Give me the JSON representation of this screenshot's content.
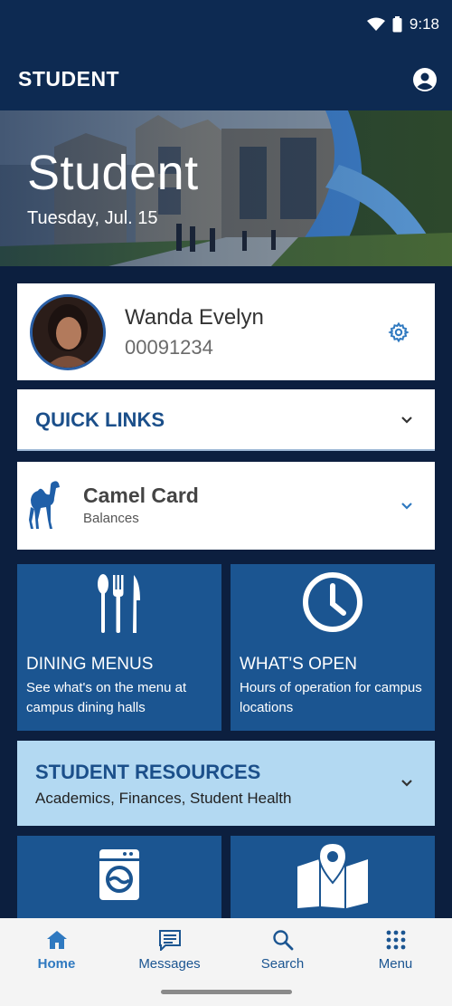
{
  "status_bar": {
    "time": "9:18"
  },
  "app_bar": {
    "title": "STUDENT"
  },
  "hero": {
    "title": "Student",
    "date": "Tuesday, Jul. 15"
  },
  "profile": {
    "name": "Wanda Evelyn",
    "id": "00091234"
  },
  "quick_links": {
    "label": "QUICK LINKS"
  },
  "camel_card": {
    "title": "Camel Card",
    "subtitle": "Balances"
  },
  "tiles": [
    {
      "title": "DINING MENUS",
      "description": "See what's on the menu at campus dining halls",
      "icon": "utensils-icon"
    },
    {
      "title": "WHAT'S OPEN",
      "description": "Hours of operation for campus locations",
      "icon": "clock-icon"
    },
    {
      "title": "",
      "description": "",
      "icon": "laundry-icon"
    },
    {
      "title": "",
      "description": "",
      "icon": "map-icon"
    }
  ],
  "student_resources": {
    "title": "STUDENT RESOURCES",
    "subtitle": "Academics, Finances, Student Health"
  },
  "bottom_nav": [
    {
      "label": "Home",
      "icon": "home-icon",
      "active": true
    },
    {
      "label": "Messages",
      "icon": "messages-icon",
      "active": false
    },
    {
      "label": "Search",
      "icon": "search-icon",
      "active": false
    },
    {
      "label": "Menu",
      "icon": "grid-menu-icon",
      "active": false
    }
  ],
  "colors": {
    "header": "#0d2a52",
    "tile": "#1b5591",
    "accent": "#2f79c0",
    "resources": "#b3d9f2",
    "background": "#0c1f3f"
  }
}
